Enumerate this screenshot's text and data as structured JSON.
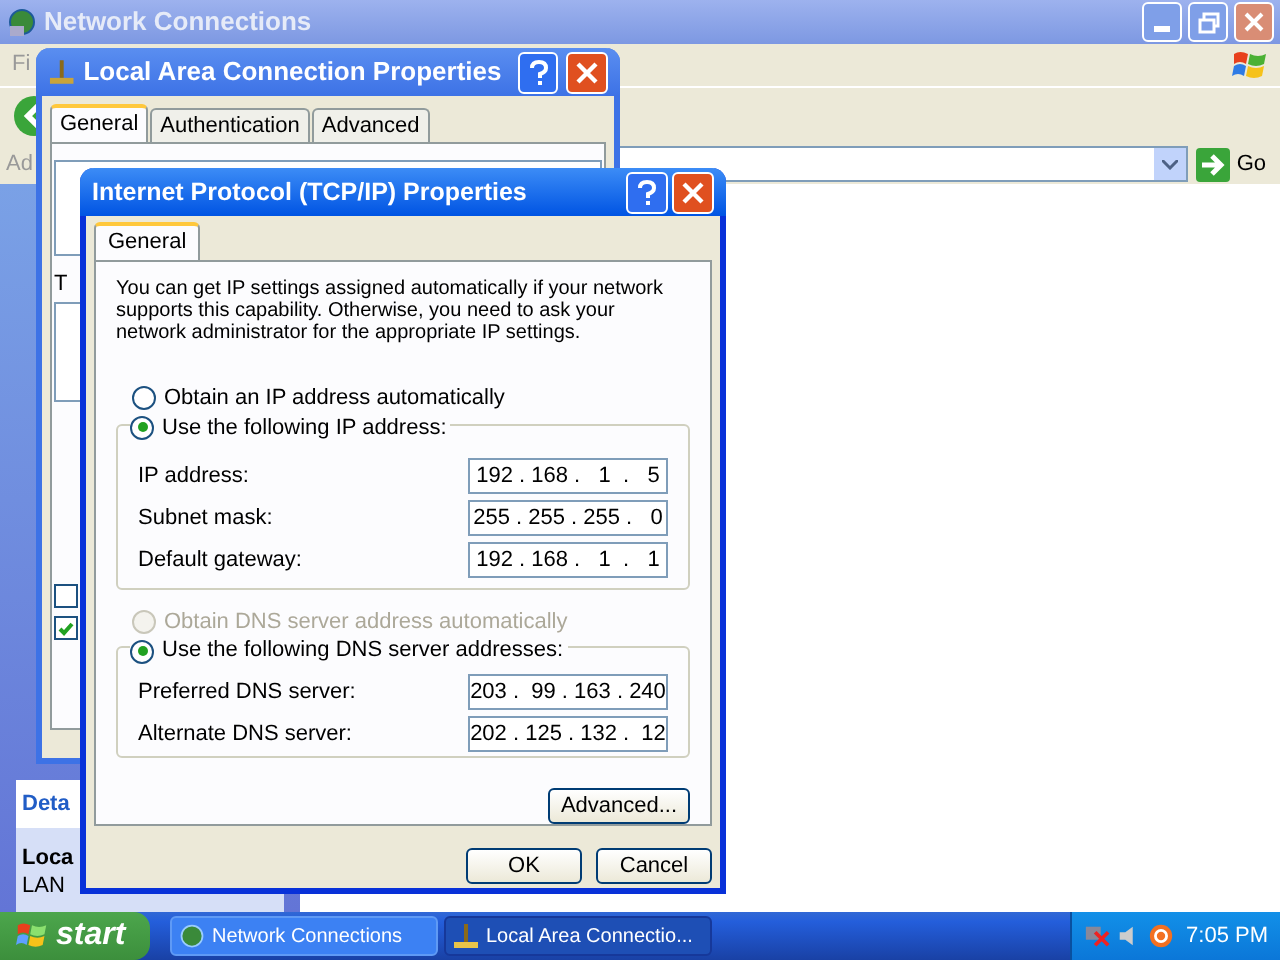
{
  "main_window": {
    "title": "Network Connections",
    "menu_fragment": "Fi",
    "address_fragment": "Ad",
    "go": "Go",
    "details_title_fragment": "Deta",
    "details_lines": [
      "Loca",
      "LAN"
    ]
  },
  "lan_window": {
    "title": "Local Area Connection Properties",
    "tabs": [
      {
        "label": "General",
        "selected": true
      },
      {
        "label": "Authentication",
        "selected": false
      },
      {
        "label": "Advanced",
        "selected": false
      }
    ],
    "text_fragment": "T",
    "checkboxes": [
      {
        "checked": false
      },
      {
        "checked": true
      }
    ]
  },
  "tcpip_dialog": {
    "title": "Internet Protocol (TCP/IP) Properties",
    "tabs": [
      {
        "label": "General",
        "selected": true
      }
    ],
    "description": "You can get IP settings assigned automatically if your network supports this capability. Otherwise, you need to ask your network administrator for the appropriate IP settings.",
    "ip_options": [
      {
        "label": "Obtain an IP address automatically",
        "selected": false,
        "disabled": false
      },
      {
        "label": "Use the following IP address:",
        "selected": true,
        "disabled": false
      }
    ],
    "ip_fields": [
      {
        "label": "IP address:",
        "value": "192 . 168 .   1  .   5"
      },
      {
        "label": "Subnet mask:",
        "value": "255 . 255 . 255 .   0"
      },
      {
        "label": "Default gateway:",
        "value": "192 . 168 .   1  .   1"
      }
    ],
    "dns_options": [
      {
        "label": "Obtain DNS server address automatically",
        "selected": false,
        "disabled": true
      },
      {
        "label": "Use the following DNS server addresses:",
        "selected": true,
        "disabled": false
      }
    ],
    "dns_fields": [
      {
        "label": "Preferred DNS server:",
        "value": "203 .  99 . 163 . 240"
      },
      {
        "label": "Alternate DNS server:",
        "value": "202 . 125 . 132 .  12"
      }
    ],
    "advanced_button": "Advanced...",
    "ok_button": "OK",
    "cancel_button": "Cancel"
  },
  "taskbar": {
    "start": "start",
    "tasks": [
      {
        "label": "Network Connections",
        "selected": false,
        "kind": "network"
      },
      {
        "label": "Local Area Connectio...",
        "selected": true,
        "kind": "lan"
      }
    ],
    "clock": "7:05 PM"
  }
}
